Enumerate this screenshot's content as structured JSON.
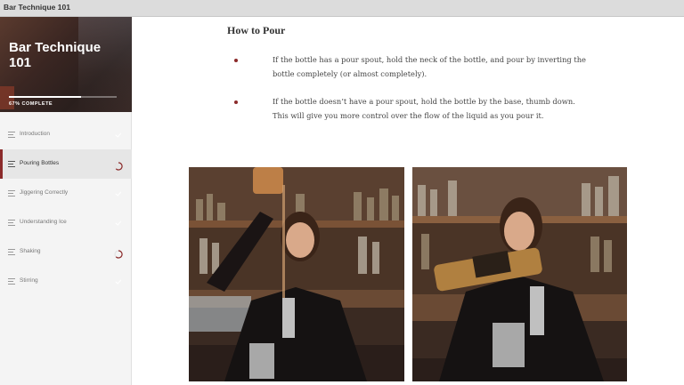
{
  "window": {
    "title": "Bar Technique 101"
  },
  "sidebar": {
    "course_title": "Bar Technique 101",
    "progress": {
      "percent": 67,
      "label": "67% COMPLETE"
    },
    "lessons": [
      {
        "label": "Introduction",
        "status": "complete",
        "active": false
      },
      {
        "label": "Pouring Bottles",
        "status": "in-progress",
        "active": true
      },
      {
        "label": "Jiggering Correctly",
        "status": "complete",
        "active": false
      },
      {
        "label": "Understanding Ice",
        "status": "complete",
        "active": false
      },
      {
        "label": "Shaking",
        "status": "in-progress",
        "active": false
      },
      {
        "label": "Stirring",
        "status": "complete",
        "active": false
      }
    ]
  },
  "main": {
    "heading": "How to Pour",
    "bullets": [
      "If the bottle has a pour spout, hold the neck of the bottle, and pour by inverting the bottle completely (or almost completely).",
      "If the bottle doesn’t have a pour spout, hold the bottle by the base, thumb down. This will give you more control over the flow of the liquid as you pour it."
    ]
  },
  "colors": {
    "accent": "#8b2a2a",
    "sidebar_bg": "#f4f4f4",
    "titlebar_bg": "#dcdcdc"
  }
}
